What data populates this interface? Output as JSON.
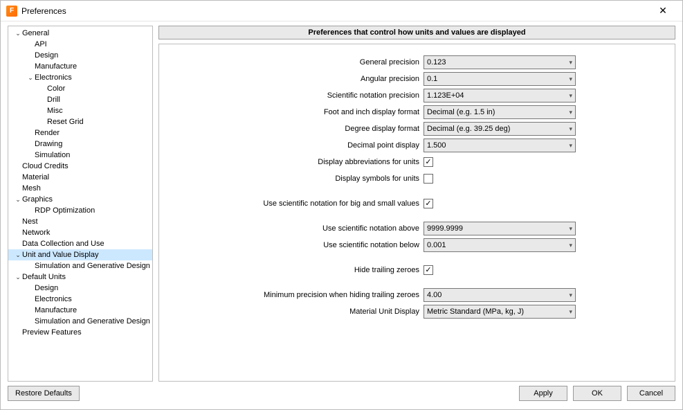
{
  "window": {
    "title": "Preferences"
  },
  "panel": {
    "header": "Preferences that control how units and values are displayed"
  },
  "tree": [
    {
      "l": "General",
      "d": 0,
      "exp": true
    },
    {
      "l": "API",
      "d": 1
    },
    {
      "l": "Design",
      "d": 1
    },
    {
      "l": "Manufacture",
      "d": 1
    },
    {
      "l": "Electronics",
      "d": 1,
      "exp": true
    },
    {
      "l": "Color",
      "d": 2
    },
    {
      "l": "Drill",
      "d": 2
    },
    {
      "l": "Misc",
      "d": 2
    },
    {
      "l": "Reset Grid",
      "d": 2
    },
    {
      "l": "Render",
      "d": 1
    },
    {
      "l": "Drawing",
      "d": 1
    },
    {
      "l": "Simulation",
      "d": 1
    },
    {
      "l": "Cloud Credits",
      "d": 0
    },
    {
      "l": "Material",
      "d": 0
    },
    {
      "l": "Mesh",
      "d": 0
    },
    {
      "l": "Graphics",
      "d": 0,
      "exp": true
    },
    {
      "l": "RDP Optimization",
      "d": 1
    },
    {
      "l": "Nest",
      "d": 0
    },
    {
      "l": "Network",
      "d": 0
    },
    {
      "l": "Data Collection and Use",
      "d": 0
    },
    {
      "l": "Unit and Value Display",
      "d": 0,
      "exp": true,
      "sel": true
    },
    {
      "l": "Simulation and Generative Design",
      "d": 1
    },
    {
      "l": "Default Units",
      "d": 0,
      "exp": true
    },
    {
      "l": "Design",
      "d": 1
    },
    {
      "l": "Electronics",
      "d": 1
    },
    {
      "l": "Manufacture",
      "d": 1
    },
    {
      "l": "Simulation and Generative Design",
      "d": 1
    },
    {
      "l": "Preview Features",
      "d": 0
    }
  ],
  "form": {
    "general_precision": {
      "label": "General precision",
      "value": "0.123"
    },
    "angular_precision": {
      "label": "Angular precision",
      "value": "0.1"
    },
    "scientific_precision": {
      "label": "Scientific notation precision",
      "value": "1.123E+04"
    },
    "foot_inch": {
      "label": "Foot and inch display format",
      "value": "Decimal (e.g. 1.5 in)"
    },
    "degree_format": {
      "label": "Degree display format",
      "value": "Decimal (e.g. 39.25 deg)"
    },
    "decimal_point": {
      "label": "Decimal point display",
      "value": "1.500"
    },
    "abbrev": {
      "label": "Display abbreviations for units",
      "checked": true
    },
    "symbols": {
      "label": "Display symbols for units",
      "checked": false
    },
    "sci_big_small": {
      "label": "Use scientific notation for big and small values",
      "checked": true
    },
    "sci_above": {
      "label": "Use scientific notation above",
      "value": "9999.9999"
    },
    "sci_below": {
      "label": "Use scientific notation below",
      "value": "0.001"
    },
    "hide_zero": {
      "label": "Hide trailing zeroes",
      "checked": true
    },
    "min_prec": {
      "label": "Minimum precision when hiding trailing zeroes",
      "value": "4.00"
    },
    "material_unit": {
      "label": "Material Unit Display",
      "value": "Metric Standard (MPa, kg, J)"
    }
  },
  "buttons": {
    "restore": "Restore Defaults",
    "apply": "Apply",
    "ok": "OK",
    "cancel": "Cancel"
  }
}
